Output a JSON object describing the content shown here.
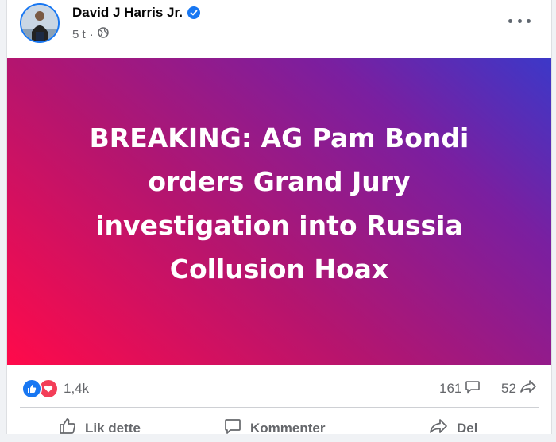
{
  "post": {
    "author": "David J Harris Jr.",
    "time": "5 t",
    "separator": "·",
    "headline": "BREAKING: AG Pam Bondi orders Grand Jury investigation into Russia Collusion Hoax"
  },
  "stats": {
    "reactions_count": "1,4k",
    "comments_count": "161",
    "shares_count": "52"
  },
  "actions": {
    "like": "Lik dette",
    "comment": "Kommenter",
    "share": "Del"
  },
  "icons": {
    "verified": "verified-badge-icon",
    "privacy": "globe-icon",
    "more": "more-options-icon",
    "like_reaction": "like-reaction-icon",
    "love_reaction": "love-reaction-icon",
    "comment": "comment-icon",
    "share": "share-icon"
  },
  "colors": {
    "brand": "#1877f2",
    "love": "#f33e58",
    "gradient_start": "#ff0a4a",
    "gradient_end": "#3c38c8"
  }
}
